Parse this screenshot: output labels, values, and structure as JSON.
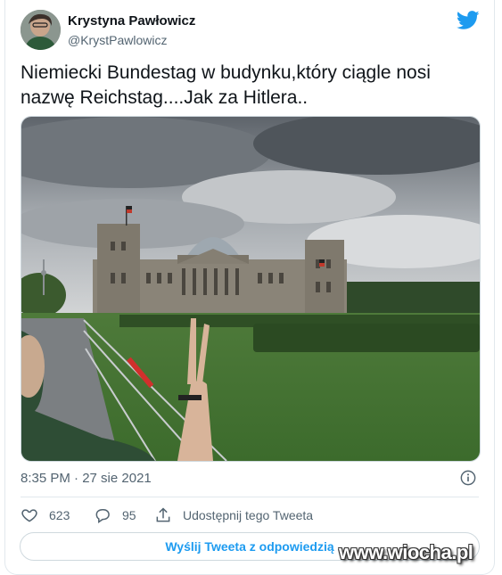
{
  "tweet": {
    "author_name": "Krystyna Pawłowicz",
    "author_handle": "@KrystPawlowicz",
    "text": "Niemiecki Bundestag w budynku,który ciągle nosi nazwę Reichstag....Jak za Hitlera..",
    "timestamp": "8:35 PM · 27 sie 2021",
    "likes": "623",
    "replies": "95",
    "share_label": "Udostępnij tego Tweeta",
    "reply_button_label": "Wyślij Tweeta z odpowiedzią"
  },
  "watermark": "www.wiocha.pl",
  "colors": {
    "accent": "#1d9bf0",
    "muted": "#536471",
    "border": "#cfd9de"
  },
  "icons": [
    "twitter-bird-icon",
    "info-icon",
    "heart-icon",
    "comment-icon",
    "share-icon"
  ]
}
